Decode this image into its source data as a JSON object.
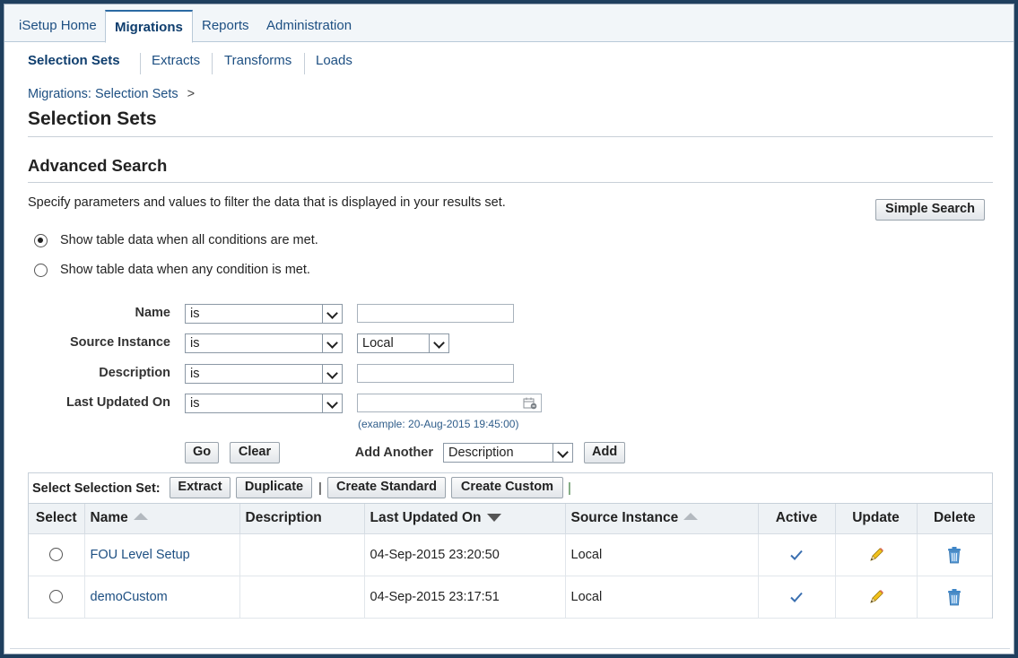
{
  "tabs": [
    "iSetup Home",
    "Migrations",
    "Reports",
    "Administration"
  ],
  "active_tab": "Migrations",
  "subtabs": [
    "Selection Sets",
    "Extracts",
    "Transforms",
    "Loads"
  ],
  "breadcrumb": {
    "label": "Migrations: Selection Sets",
    "arrow": ">"
  },
  "page_title": "Selection Sets",
  "search": {
    "title": "Advanced Search",
    "instructions": "Specify parameters and values to filter the data that is displayed in your results set.",
    "simple_search_label": "Simple Search",
    "radio_all": "Show table data when all conditions are met.",
    "radio_any": "Show table data when any condition is met.",
    "fields": [
      {
        "label": "Name",
        "operator": "is",
        "value": ""
      },
      {
        "label": "Source Instance",
        "operator": "is",
        "value": "Local"
      },
      {
        "label": "Description",
        "operator": "is",
        "value": ""
      },
      {
        "label": "Last Updated On",
        "operator": "is",
        "value": ""
      }
    ],
    "date_hint": "(example: 20-Aug-2015 19:45:00)",
    "go_label": "Go",
    "clear_label": "Clear",
    "add_another_label": "Add Another",
    "add_another_value": "Description",
    "add_label": "Add"
  },
  "table": {
    "toolbar_label": "Select Selection Set:",
    "toolbar_buttons": [
      "Extract",
      "Duplicate",
      "Create Standard",
      "Create Custom"
    ],
    "separator": "|",
    "columns": [
      "Select",
      "Name",
      "Description",
      "Last Updated On",
      "Source Instance",
      "Active",
      "Update",
      "Delete"
    ],
    "rows": [
      {
        "name": "FOU Level Setup",
        "description": "",
        "last_updated": "04-Sep-2015 23:20:50",
        "source": "Local"
      },
      {
        "name": "demoCustom",
        "description": "",
        "last_updated": "04-Sep-2015 23:17:51",
        "source": "Local"
      }
    ]
  },
  "icons": {
    "active": "checkmark-icon",
    "update": "pencil-icon",
    "delete": "trash-icon",
    "calendar": "calendar-icon"
  },
  "colors": {
    "link": "#1d4f82",
    "frame": "#1f3f5e",
    "check": "#3a6fb0"
  }
}
